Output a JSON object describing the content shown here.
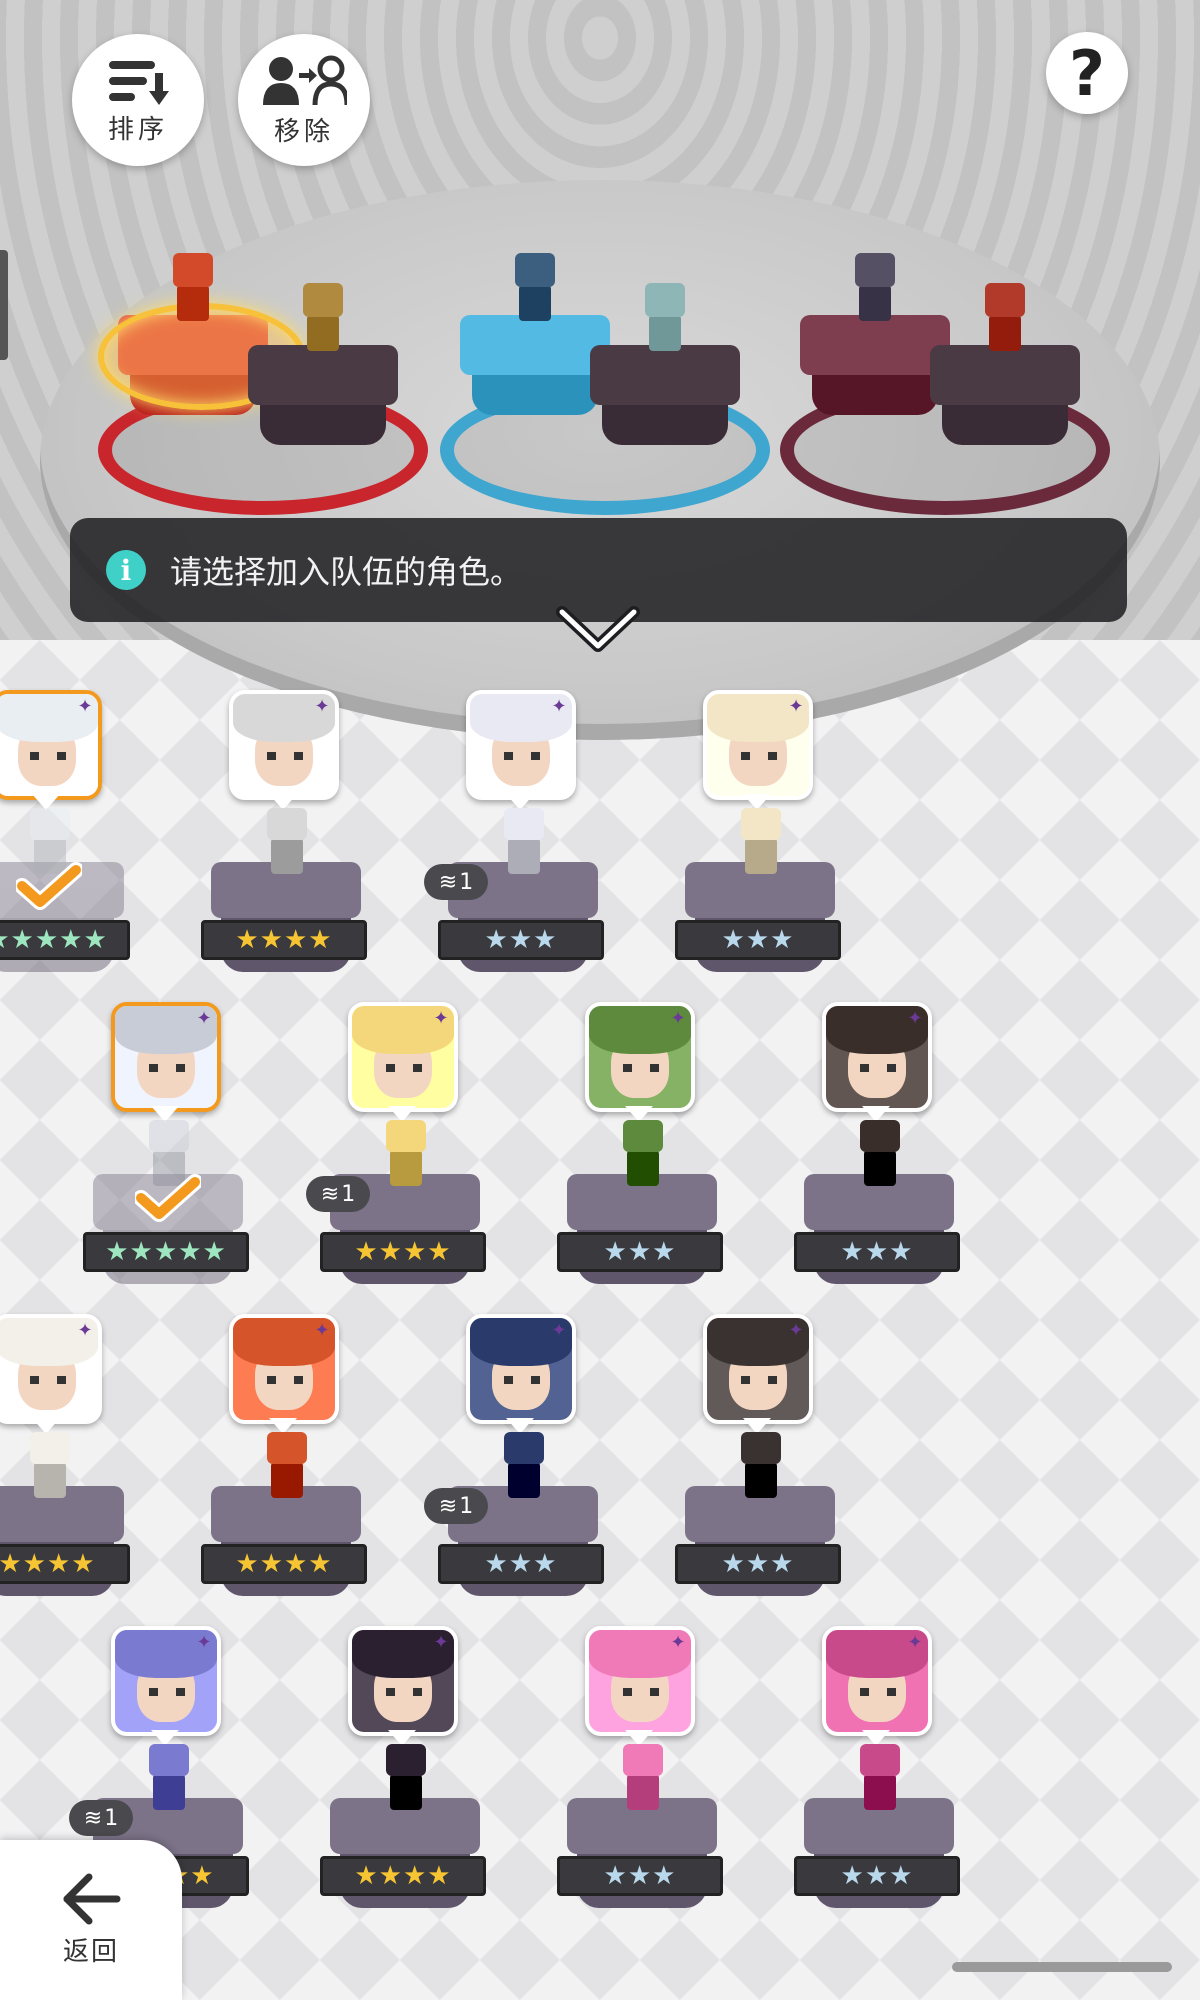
{
  "toolbar": {
    "sort_label": "排序",
    "remove_label": "移除",
    "help_glyph": "?"
  },
  "info": {
    "message": "请选择加入队伍的角色。"
  },
  "back": {
    "label": "返回"
  },
  "teams": [
    {
      "base_color": "#c8262c",
      "slots": [
        {
          "hero_color": "#d34a2a",
          "selected": true
        },
        {
          "hero_color": "#b08a3e",
          "selected": false
        }
      ]
    },
    {
      "base_color": "#3ea6cf",
      "slots": [
        {
          "hero_color": "#3c5f80",
          "selected": false
        },
        {
          "hero_color": "#8fb6b6",
          "selected": false
        }
      ]
    },
    {
      "base_color": "#6a2a3c",
      "slots": [
        {
          "hero_color": "#555064",
          "selected": false
        },
        {
          "hero_color": "#b23a2a",
          "selected": false
        }
      ]
    }
  ],
  "characters": [
    {
      "stars": "★★★★★",
      "tier": "rainbow",
      "selected": true,
      "in_team": true,
      "dup": "",
      "hair": "#e8eef2"
    },
    {
      "stars": "★★★★",
      "tier": "gold",
      "selected": false,
      "in_team": false,
      "dup": "",
      "hair": "#d8d8d8"
    },
    {
      "stars": "★★★",
      "tier": "silver",
      "selected": false,
      "in_team": false,
      "dup": "1",
      "hair": "#e9e9f3"
    },
    {
      "stars": "★★★",
      "tier": "silver",
      "selected": false,
      "in_team": false,
      "dup": "",
      "hair": "#f2e6c6"
    },
    {
      "stars": "★★★★★",
      "tier": "rainbow",
      "selected": true,
      "in_team": true,
      "dup": "",
      "hair": "#c8ccd6"
    },
    {
      "stars": "★★★★",
      "tier": "gold",
      "selected": false,
      "in_team": false,
      "dup": "1",
      "hair": "#f4d77a"
    },
    {
      "stars": "★★★",
      "tier": "silver",
      "selected": false,
      "in_team": false,
      "dup": "",
      "hair": "#5d8a3c"
    },
    {
      "stars": "★★★",
      "tier": "silver",
      "selected": false,
      "in_team": false,
      "dup": "",
      "hair": "#3a2e2a"
    },
    {
      "stars": "★★★★",
      "tier": "gold",
      "selected": false,
      "in_team": false,
      "dup": "",
      "hair": "#f3f0ea"
    },
    {
      "stars": "★★★★",
      "tier": "gold",
      "selected": false,
      "in_team": false,
      "dup": "",
      "hair": "#d5542a"
    },
    {
      "stars": "★★★",
      "tier": "silver",
      "selected": false,
      "in_team": false,
      "dup": "1",
      "hair": "#2a3a6a"
    },
    {
      "stars": "★★★",
      "tier": "silver",
      "selected": false,
      "in_team": false,
      "dup": "",
      "hair": "#3a3230"
    },
    {
      "stars": "★★★★",
      "tier": "gold",
      "selected": false,
      "in_team": false,
      "dup": "1",
      "hair": "#7a7ad0"
    },
    {
      "stars": "★★★★",
      "tier": "gold",
      "selected": false,
      "in_team": false,
      "dup": "",
      "hair": "#2a2030"
    },
    {
      "stars": "★★★",
      "tier": "silver",
      "selected": false,
      "in_team": false,
      "dup": "",
      "hair": "#f07ab8"
    },
    {
      "stars": "★★★",
      "tier": "silver",
      "selected": false,
      "in_team": false,
      "dup": "",
      "hair": "#c84a8a"
    }
  ],
  "element_glyph": "✦"
}
